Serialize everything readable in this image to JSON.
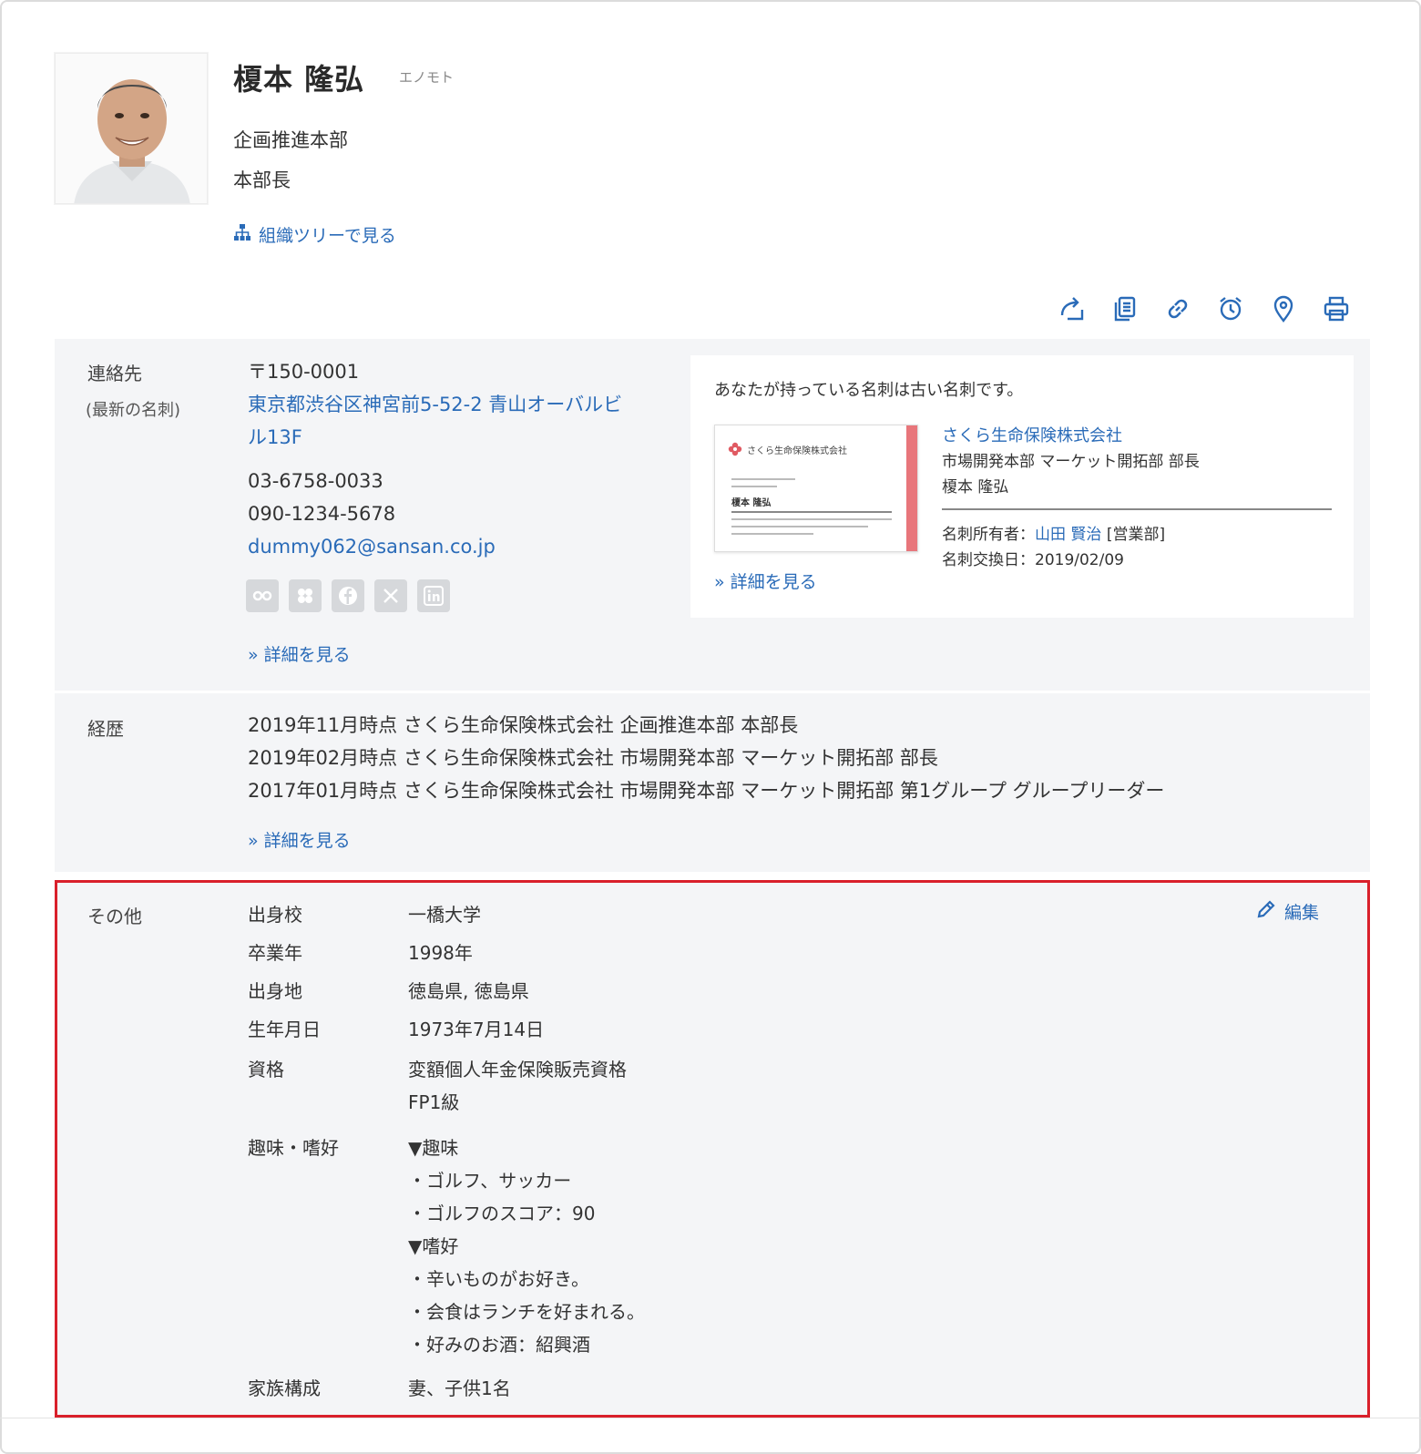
{
  "profile": {
    "name": "榎本 隆弘",
    "kana": "エノモト",
    "department": "企画推進本部",
    "position": "本部長",
    "org_tree_link": "組織ツリーで見る"
  },
  "toolbar": {
    "icons": [
      "share-icon",
      "copy-icon",
      "link-icon",
      "alarm-icon",
      "location-icon",
      "print-icon"
    ]
  },
  "contact": {
    "label": "連絡先",
    "sub_label": "(最新の名刺)",
    "postal": "〒150-0001",
    "address_line1": "東京都渋谷区神宮前5-52-2 青山オーバルビ",
    "address_line2": "ル13F",
    "phone1": "03-6758-0033",
    "phone2": "090-1234-5678",
    "email": "dummy062@sansan.co.jp",
    "social_icons": [
      "eight-icon",
      "flower-icon",
      "facebook-icon",
      "x-icon",
      "linkedin-icon"
    ],
    "detail_link": "» 詳細を見る"
  },
  "card": {
    "notice": "あなたが持っている名刺は古い名刺です。",
    "company": "さくら生命保険株式会社",
    "title": "市場開発本部 マーケット開拓部 部長",
    "name": "榎本 隆弘",
    "owner_label": "名刺所有者：",
    "owner_name": "山田 賢治",
    "owner_dept": "[営業部]",
    "exchange_date": "名刺交換日：2019/02/09",
    "detail_link": "» 詳細を見る",
    "image_company": "さくら生命保険株式会社",
    "image_name": "榎本 隆弘"
  },
  "career": {
    "label": "経歴",
    "entries": [
      "2019年11月時点 さくら生命保険株式会社 企画推進本部 本部長",
      "2019年02月時点 さくら生命保険株式会社 市場開発本部 マーケット開拓部 部長",
      "2017年01月時点 さくら生命保険株式会社 市場開発本部 マーケット開拓部 第1グループ グループリーダー"
    ],
    "detail_link": "» 詳細を見る"
  },
  "other": {
    "label": "その他",
    "edit_label": "編集",
    "school_key": "出身校",
    "school_val": "一橋大学",
    "grad_key": "卒業年",
    "grad_val": "1998年",
    "home_key": "出身地",
    "home_val": "徳島県, 徳島県",
    "birth_key": "生年月日",
    "birth_val": "1973年7月14日",
    "qual_key": "資格",
    "qual_lines": [
      "変額個人年金保険販売資格",
      "FP1級"
    ],
    "hobby_key": "趣味・嗜好",
    "hobby_lines": [
      "▼趣味",
      "・ゴルフ、サッカー",
      "・ゴルフのスコア：90",
      "▼嗜好",
      "・辛いものがお好き。",
      "・会食はランチを好まれる。",
      "・好みのお酒：紹興酒"
    ],
    "family_key": "家族構成",
    "family_val": "妻、子供1名"
  },
  "colors": {
    "link": "#2a6bb8",
    "section_bg": "#f4f5f7",
    "highlight_border": "#d9202b"
  }
}
